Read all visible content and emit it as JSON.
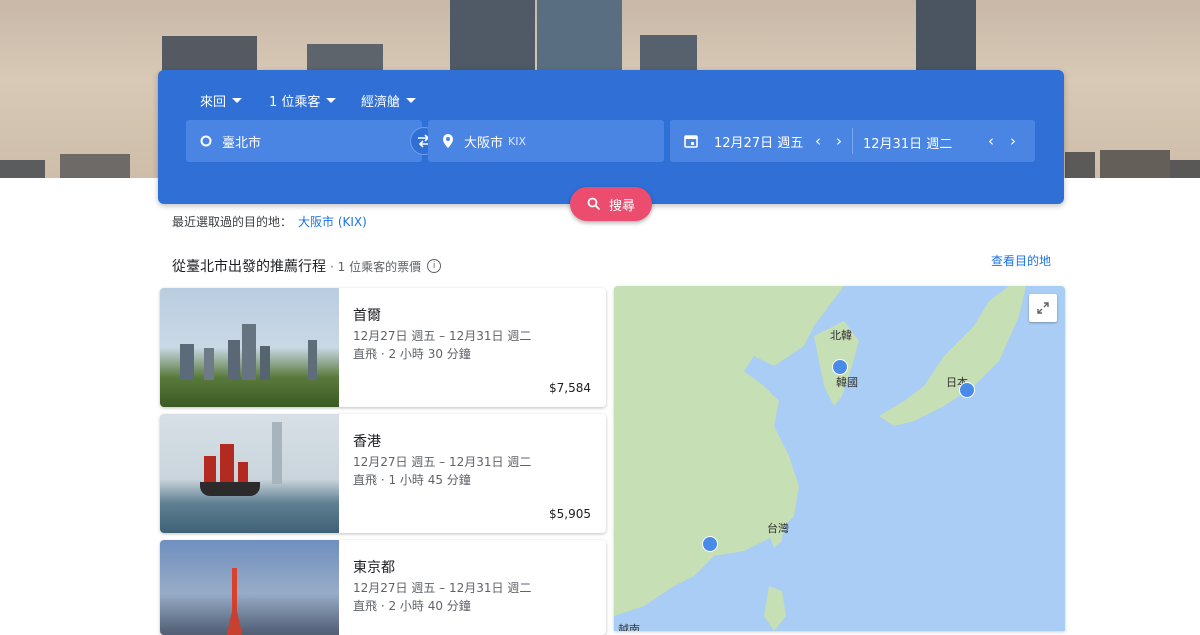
{
  "search": {
    "trip_type": "來回",
    "passengers": "1 位乘客",
    "cabin": "經濟艙",
    "origin": "臺北市",
    "destination": "大阪市",
    "destination_code": "KIX",
    "depart_date": "12月27日 週五",
    "return_date": "12月31日 週二",
    "search_label": "搜尋"
  },
  "recent": {
    "label": "最近選取過的目的地：",
    "link": "大阪市 (KIX)"
  },
  "section": {
    "title": "從臺北市出發的推薦行程",
    "subtitle": "· 1 位乘客的票價",
    "info_icon": "i",
    "view_destinations": "查看目的地"
  },
  "trips": [
    {
      "city": "首爾",
      "dates": "12月27日 週五 – 12月31日 週二",
      "duration": "直飛 · 2 小時 30 分鐘",
      "price": "$7,584"
    },
    {
      "city": "香港",
      "dates": "12月27日 週五 – 12月31日 週二",
      "duration": "直飛 · 1 小時 45 分鐘",
      "price": "$5,905"
    },
    {
      "city": "東京都",
      "dates": "12月27日 週五 – 12月31日 週二",
      "duration": "直飛 · 2 小時 40 分鐘",
      "price": ""
    }
  ],
  "map": {
    "labels": {
      "north_korea": "北韓",
      "korea": "韓國",
      "japan": "日本",
      "taiwan": "台灣",
      "vietnam": "越南"
    }
  },
  "colors": {
    "panel": "#2f6fd6",
    "field": "#4a85e3",
    "search_button": "#ec4d6f",
    "link": "#1a73e8",
    "sea": "#a9cdf4",
    "land": "#c7dfb4"
  },
  "icons": {
    "trip_caret": "caret-down-icon",
    "origin": "circle-icon",
    "destination": "place-icon",
    "swap": "swap-icon",
    "calendar": "calendar-icon",
    "search": "search-icon",
    "expand": "expand-icon"
  }
}
